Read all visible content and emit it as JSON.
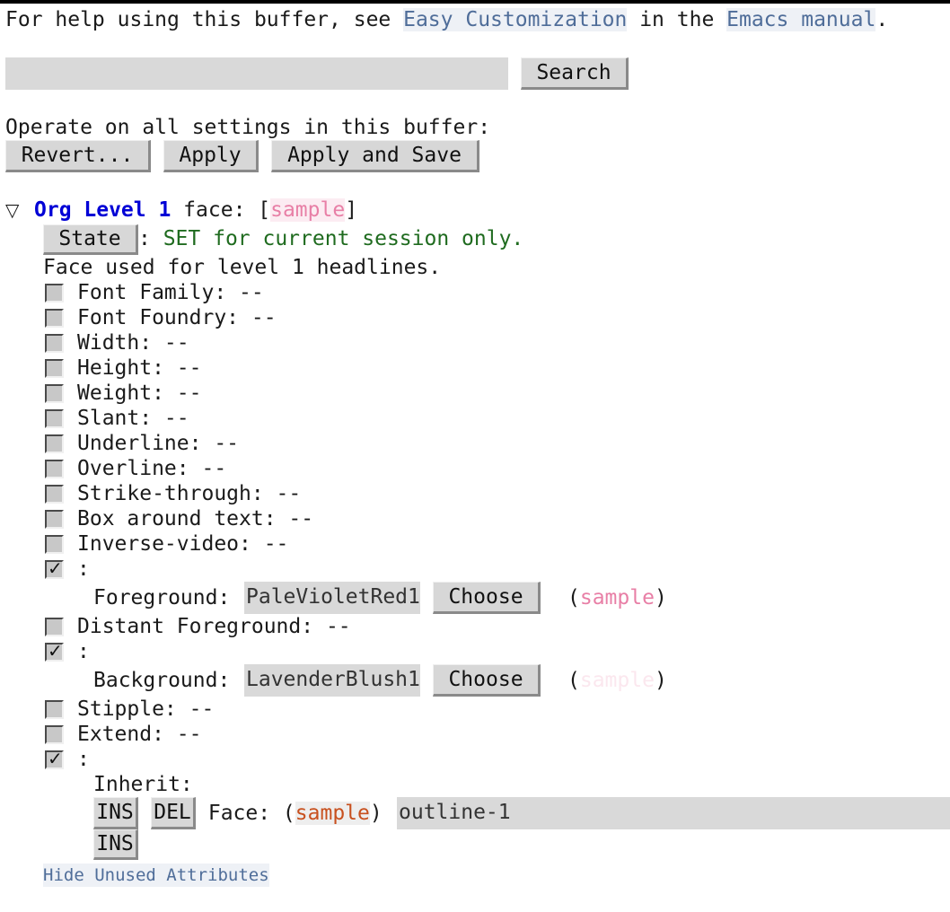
{
  "help": {
    "prefix": "For help using this buffer, see ",
    "link1": "Easy Customization",
    "middle": " in the ",
    "link2": "Emacs manual",
    "suffix": "."
  },
  "search": {
    "value": "",
    "button": "Search"
  },
  "operate": {
    "label": "Operate on all settings in this buffer:",
    "revert": "Revert...",
    "apply": "Apply",
    "apply_save": "Apply and Save"
  },
  "face": {
    "toggle_icon": "▽",
    "name": "Org Level 1",
    "label": " face: [",
    "sample": "sample",
    "label_end": "]",
    "state_button": "State",
    "state_sep": ": ",
    "state_text": "SET for current session only.",
    "doc": "Face used for level 1 headlines."
  },
  "attributes": [
    {
      "label": "Font Family: --",
      "checked": false
    },
    {
      "label": "Font Foundry: --",
      "checked": false
    },
    {
      "label": "Width: --",
      "checked": false
    },
    {
      "label": "Height: --",
      "checked": false
    },
    {
      "label": "Weight: --",
      "checked": false
    },
    {
      "label": "Slant: --",
      "checked": false
    },
    {
      "label": "Underline: --",
      "checked": false
    },
    {
      "label": "Overline: --",
      "checked": false
    },
    {
      "label": "Strike-through: --",
      "checked": false
    },
    {
      "label": "Box around text: --",
      "checked": false
    },
    {
      "label": "Inverse-video: --",
      "checked": false
    }
  ],
  "foreground": {
    "checked": true,
    "colon": ":",
    "label": "Foreground: ",
    "value": "PaleVioletRed1",
    "choose": "Choose",
    "open": "(",
    "sample": "sample",
    "close": ")",
    "sample_color": "#ee799f"
  },
  "distant": {
    "label": "Distant Foreground: --",
    "checked": false
  },
  "background": {
    "checked": true,
    "colon": ":",
    "label": "Background: ",
    "value": "LavenderBlush1",
    "choose": "Choose",
    "open": "(",
    "sample": "sample",
    "close": ")",
    "sample_color": "#fff0f5"
  },
  "stipple": {
    "label": "Stipple: --",
    "checked": false
  },
  "extend": {
    "label": "Extend: --",
    "checked": false
  },
  "inherit": {
    "checked": true,
    "colon": ":",
    "label": "Inherit:",
    "ins": "INS",
    "del": "DEL",
    "face_label": " Face: (",
    "sample": "sample",
    "close": ")",
    "value": "outline-1",
    "ins2": "INS"
  },
  "hide_link": "Hide Unused Attributes",
  "colors": {
    "link": "#4f6d99",
    "face_name": "#0000d6",
    "state_text": "#1f6b1f",
    "button_bg": "#d7d7d7",
    "field_bg": "#d9d9d9"
  }
}
